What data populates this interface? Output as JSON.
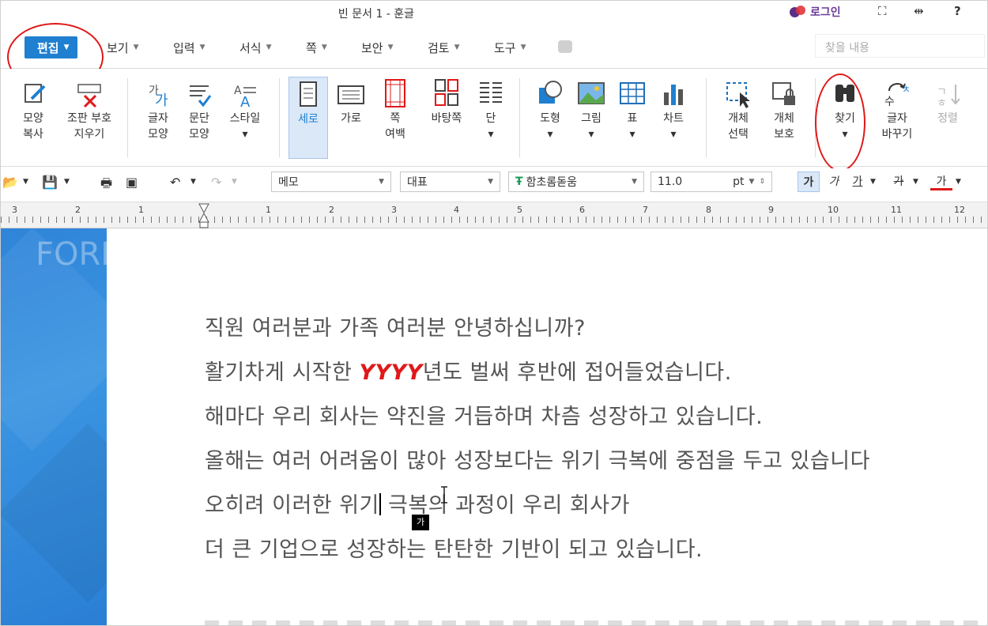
{
  "window": {
    "title": "빈 문서 1 - 훈글",
    "login": "로그인",
    "controls": [
      "⛶",
      "⇹",
      "?"
    ]
  },
  "menu": {
    "tabs": [
      {
        "label": "편집",
        "active": true
      },
      {
        "label": "보기"
      },
      {
        "label": "입력"
      },
      {
        "label": "서식"
      },
      {
        "label": "쪽"
      },
      {
        "label": "보안"
      },
      {
        "label": "검토"
      },
      {
        "label": "도구"
      }
    ],
    "search_placeholder": "찾을 내용"
  },
  "ribbon": {
    "shape_copy": {
      "l1": "모양",
      "l2": "복사"
    },
    "erase_codes": {
      "l1": "조판 부호",
      "l2": "지우기"
    },
    "char_shape": {
      "l1": "글자",
      "l2": "모양"
    },
    "para_shape": {
      "l1": "문단",
      "l2": "모양"
    },
    "style": {
      "l1": "스타일"
    },
    "portrait": {
      "l1": "세로"
    },
    "landscape": {
      "l1": "가로"
    },
    "margin": {
      "l1": "쪽",
      "l2": "여백"
    },
    "background": {
      "l1": "바탕쪽"
    },
    "columns": {
      "l1": "단"
    },
    "shape": {
      "l1": "도형"
    },
    "picture": {
      "l1": "그림"
    },
    "table": {
      "l1": "표"
    },
    "chart": {
      "l1": "차트"
    },
    "obj_select": {
      "l1": "개체",
      "l2": "선택"
    },
    "obj_protect": {
      "l1": "개체",
      "l2": "보호"
    },
    "find": {
      "l1": "찾기"
    },
    "replace": {
      "l1": "글자",
      "l2": "바꾸기"
    },
    "sort": {
      "l1": "정렬"
    }
  },
  "toolbar": {
    "style_value": "메모",
    "lang_value": "대표",
    "font_value": "함초롬돋움",
    "size_value": "11.0",
    "unit_value": "pt",
    "bold": "가",
    "italic": "가",
    "underline": "가",
    "strike": "가",
    "color": "가"
  },
  "ruler": {
    "labels": [
      "3",
      "2",
      "1",
      "1",
      "2",
      "3",
      "4",
      "5",
      "6",
      "7",
      "8",
      "9",
      "10",
      "11",
      "12"
    ]
  },
  "side_banner": "FORMATION",
  "document": {
    "lines": [
      "직원 여러분과 가족 여러분 안녕하십니까?",
      "활기차게 시작한 ",
      "년도 벌써 후반에 접어들었습니다.",
      "해마다 우리 회사는 약진을 거듭하며 차츰 성장하고 있습니다.",
      "올해는 여러 어려움이 많아 성장보다는 위기 극복에 중점을 두고 있습니다",
      "오히려 이러한 위기",
      " 극복의 과정이 우리 회사가",
      "더 큰 기업으로 성장하는 탄탄한 기반이 되고 있습니다."
    ],
    "year_placeholder": "YYYY",
    "ime_char": "가"
  },
  "colors": {
    "accent": "#1f7fd0",
    "highlight_red": "#e01818",
    "banner_blue": "#2f84d8"
  }
}
